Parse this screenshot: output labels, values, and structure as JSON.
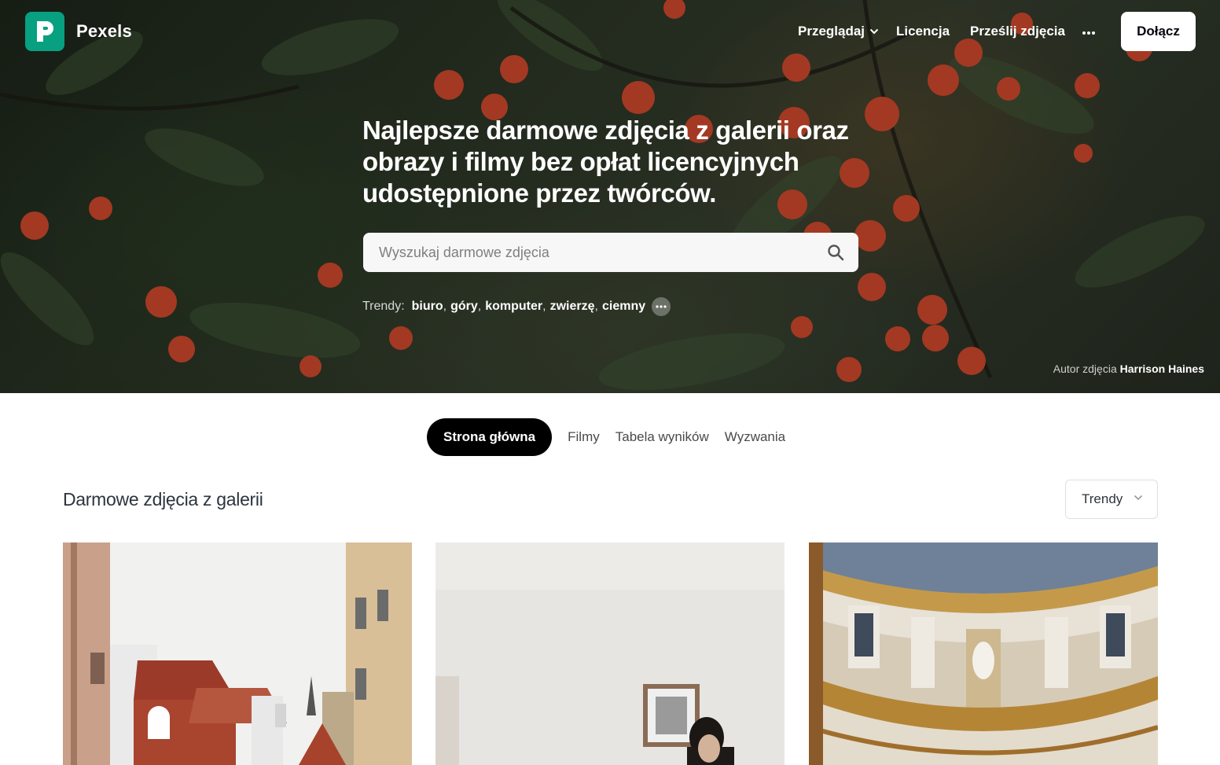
{
  "brand": {
    "name": "Pexels",
    "accent": "#07a081"
  },
  "nav": {
    "browse_label": "Przeglądaj",
    "license_label": "Licencja",
    "upload_label": "Prześlij zdjęcia",
    "more_icon": "ellipsis-icon",
    "join_label": "Dołącz"
  },
  "hero": {
    "headline": "Najlepsze darmowe zdjęcia z galerii oraz obrazy i filmy bez opłat licencyjnych udostępnione przez twórców.",
    "search_placeholder": "Wyszukaj darmowe zdjęcia",
    "trends_label": "Trendy:",
    "trends": [
      "biuro",
      "góry",
      "komputer",
      "zwierzę",
      "ciemny"
    ],
    "credit_prefix": "Autor zdjęcia",
    "credit_author": "Harrison Haines"
  },
  "tabs": [
    {
      "label": "Strona główna",
      "active": true
    },
    {
      "label": "Filmy",
      "active": false
    },
    {
      "label": "Tabela wyników",
      "active": false
    },
    {
      "label": "Wyzwania",
      "active": false
    }
  ],
  "gallery": {
    "title": "Darmowe zdjęcia z galerii",
    "sort_label": "Trendy"
  }
}
